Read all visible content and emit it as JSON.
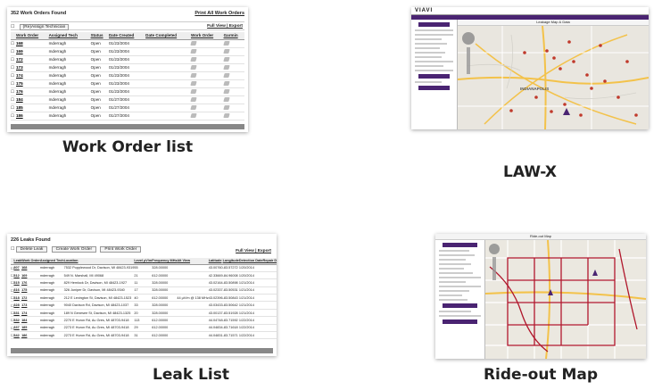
{
  "captions": {
    "work_order": "Work Order list",
    "lawx": "LAW-X",
    "leak": "Leak List",
    "ride": "Ride-out Map"
  },
  "work_orders": {
    "count_title": "352 Work Orders Found",
    "print_all": "Print All Work Orders",
    "reassign_label": "(Re)Assign Technician",
    "view_export": "Full View | Export",
    "columns": [
      "Work Order",
      "Assigned Tech",
      "Status",
      "Date Created",
      "Date Completed",
      "Work Order",
      "Garmin"
    ],
    "rows": [
      {
        "id": "168",
        "tech": "mderragh",
        "status": "Open",
        "created": "01/23/2004"
      },
      {
        "id": "169",
        "tech": "mderragh",
        "status": "Open",
        "created": "01/23/2004"
      },
      {
        "id": "172",
        "tech": "mderragh",
        "status": "Open",
        "created": "01/23/2004"
      },
      {
        "id": "173",
        "tech": "mderragh",
        "status": "Open",
        "created": "01/23/2004"
      },
      {
        "id": "174",
        "tech": "mderragh",
        "status": "Open",
        "created": "01/23/2004"
      },
      {
        "id": "175",
        "tech": "mderragh",
        "status": "Open",
        "created": "01/23/2004"
      },
      {
        "id": "176",
        "tech": "mderragh",
        "status": "Open",
        "created": "01/23/2004"
      },
      {
        "id": "184",
        "tech": "mderragh",
        "status": "Open",
        "created": "01/27/2004"
      },
      {
        "id": "185",
        "tech": "mderragh",
        "status": "Open",
        "created": "01/27/2004"
      },
      {
        "id": "186",
        "tech": "mderragh",
        "status": "Open",
        "created": "01/27/2004"
      }
    ]
  },
  "leaks": {
    "count_title": "226 Leaks Found",
    "delete_label": "Delete Leak",
    "create_wo_label": "Create Work Order",
    "print_wo_label": "Print Work Order",
    "view_export": "Full View | Export",
    "columns": [
      "Leak",
      "Work Order",
      "Assigned Tech",
      "Location",
      "Level µV/m",
      "Frequency MHz",
      "Alt View",
      "Latitude",
      "Longitude",
      "Detection Date",
      "Repair Date"
    ],
    "rows": [
      {
        "leak": "307",
        "wo": "168",
        "tech": "mderragh",
        "loc": "7532 Popplewood Dr, Davison, MI 48423-9319",
        "level": "55",
        "freq": "328.00000",
        "alt": "",
        "lat": "43.00760",
        "lon": "-83.57272",
        "date": "1/20/2014"
      },
      {
        "leak": "312",
        "wo": "169",
        "tech": "mderragh",
        "loc": "549 N. Marshall, MI 49068",
        "level": "21",
        "freq": "612.00000",
        "alt": "",
        "lat": "42.33669",
        "lon": "-84.96008",
        "date": "1/20/2014"
      },
      {
        "leak": "315",
        "wo": "176",
        "tech": "mderragh",
        "loc": "829 Hemlock Dr, Davison, MI 48423-1927",
        "level": "11",
        "freq": "328.00000",
        "alt": "",
        "lat": "43.02164",
        "lon": "-83.50898",
        "date": "1/21/2014"
      },
      {
        "leak": "316",
        "wo": "175",
        "tech": "mderragh",
        "loc": "326 Juniper Dr, Davison, MI 48423-9340",
        "level": "17",
        "freq": "328.00000",
        "alt": "",
        "lat": "43.02337",
        "lon": "-83.50531",
        "date": "1/21/2014"
      },
      {
        "leak": "318",
        "wo": "172",
        "tech": "mderragh",
        "loc": "212 E Lexington St, Davison, MI 48423-1523",
        "level": "40",
        "freq": "612.00000",
        "alt": "44 µV/m @ 138 MHz",
        "lat": "43.02396",
        "lon": "-83.50843",
        "date": "1/21/2014"
      },
      {
        "leak": "328",
        "wo": "173",
        "tech": "mderragh",
        "loc": "9040 Davison Rd, Davison, MI 48423-1037",
        "level": "33",
        "freq": "328.00000",
        "alt": "",
        "lat": "43.03433",
        "lon": "-83.50642",
        "date": "1/21/2014"
      },
      {
        "leak": "331",
        "wo": "174",
        "tech": "mderragh",
        "loc": "189 N Genesee St, Davison, MI 48423-1325",
        "level": "20",
        "freq": "328.00000",
        "alt": "",
        "lat": "43.00137",
        "lon": "-83.51928",
        "date": "1/21/2014"
      },
      {
        "leak": "332",
        "wo": "184",
        "tech": "mderragh",
        "loc": "2270 E Huron Rd, Au Gres, MI 48703-9418",
        "level": "113",
        "freq": "612.00000",
        "alt": "",
        "lat": "44.04748",
        "lon": "-83.71592",
        "date": "1/22/2014"
      },
      {
        "leak": "337",
        "wo": "185",
        "tech": "mderragh",
        "loc": "2273 E Huron Rd, Au Gres, MI 48703-9418",
        "level": "29",
        "freq": "612.00000",
        "alt": "",
        "lat": "44.04834",
        "lon": "-83.71618",
        "date": "1/22/2014"
      },
      {
        "leak": "342",
        "wo": "186",
        "tech": "mderragh",
        "loc": "2273 E Huron Rd, Au Gres, MI 48703-9418",
        "level": "31",
        "freq": "612.00000",
        "alt": "",
        "lat": "44.04831",
        "lon": "-83.71571",
        "date": "1/22/2014"
      }
    ]
  },
  "lawx_panel": {
    "logo": "VIAVI",
    "map_title": "Leakage Map & Data",
    "city_label": "INDIANAPOLIS"
  },
  "ride_panel": {
    "map_title": "Ride-out Map"
  },
  "colors": {
    "accent": "#4a2472",
    "leak_dot": "#c0392b",
    "route": "#b0162b"
  }
}
